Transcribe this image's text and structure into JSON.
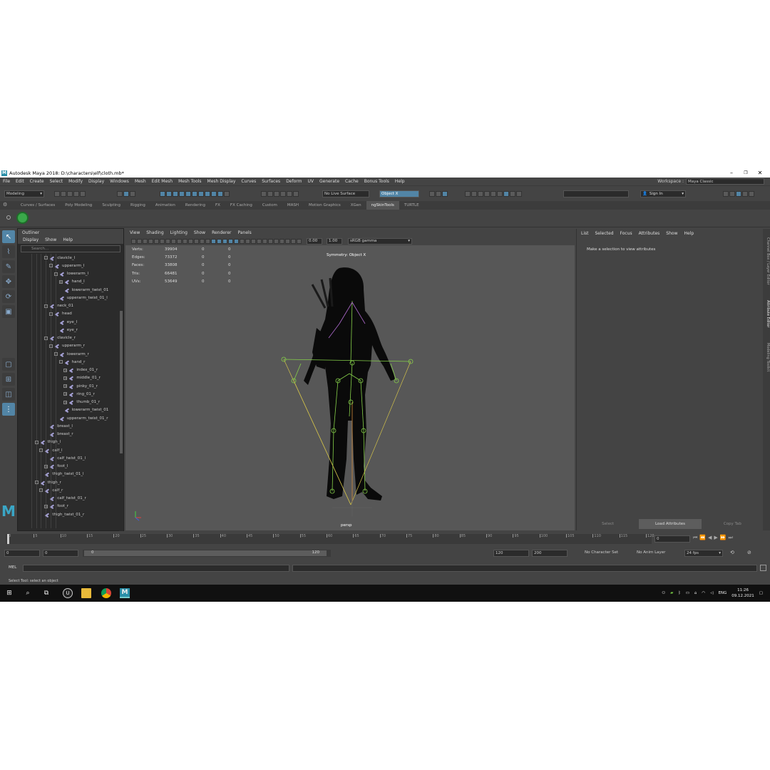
{
  "window": {
    "title": "Autodesk Maya 2018: D:\\characters\\elf\\cloth.mb*",
    "logo": "M"
  },
  "menubar": {
    "items": [
      "File",
      "Edit",
      "Create",
      "Select",
      "Modify",
      "Display",
      "Windows",
      "Mesh",
      "Edit Mesh",
      "Mesh Tools",
      "Mesh Display",
      "Curves",
      "Surfaces",
      "Deform",
      "UV",
      "Generate",
      "Cache",
      "Bonus Tools",
      "Help"
    ],
    "workspace_label": "Workspace :",
    "workspace_value": "Maya Classic"
  },
  "statusline": {
    "mode": "Modeling",
    "live_surface": "No Live Surface",
    "symmetry": "Object X",
    "sign_in": "Sign In"
  },
  "shelf": {
    "tabs": [
      "Curves / Surfaces",
      "Poly Modeling",
      "Sculpting",
      "Rigging",
      "Animation",
      "Rendering",
      "FX",
      "FX Caching",
      "Custom",
      "MASH",
      "Motion Graphics",
      "XGen",
      "ngSkinTools",
      "TURTLE"
    ],
    "active_tab": "ngSkinTools"
  },
  "outliner": {
    "title": "Outliner",
    "menu": [
      "Display",
      "Show",
      "Help"
    ],
    "search_placeholder": "Search...",
    "nodes": [
      {
        "label": "clavicle_l",
        "depth": 4,
        "toggle": "-"
      },
      {
        "label": "upperarm_l",
        "depth": 5,
        "toggle": "-"
      },
      {
        "label": "lowerarm_l",
        "depth": 6,
        "toggle": "-"
      },
      {
        "label": "hand_l",
        "depth": 7,
        "toggle": "+"
      },
      {
        "label": "lowerarm_twist_01",
        "depth": 7,
        "toggle": ""
      },
      {
        "label": "upperarm_twist_01_l",
        "depth": 6,
        "toggle": ""
      },
      {
        "label": "neck_01",
        "depth": 4,
        "toggle": "-"
      },
      {
        "label": "head",
        "depth": 5,
        "toggle": "-"
      },
      {
        "label": "eye_l",
        "depth": 6,
        "toggle": ""
      },
      {
        "label": "eye_r",
        "depth": 6,
        "toggle": ""
      },
      {
        "label": "clavicle_r",
        "depth": 4,
        "toggle": "-"
      },
      {
        "label": "upperarm_r",
        "depth": 5,
        "toggle": "-"
      },
      {
        "label": "lowerarm_r",
        "depth": 6,
        "toggle": "-"
      },
      {
        "label": "hand_r",
        "depth": 7,
        "toggle": "-"
      },
      {
        "label": "index_01_r",
        "depth": 8,
        "toggle": "+"
      },
      {
        "label": "middle_01_r",
        "depth": 8,
        "toggle": "+"
      },
      {
        "label": "pinky_01_r",
        "depth": 8,
        "toggle": "+"
      },
      {
        "label": "ring_01_r",
        "depth": 8,
        "toggle": "+"
      },
      {
        "label": "thumb_01_r",
        "depth": 8,
        "toggle": "+"
      },
      {
        "label": "lowerarm_twist_01",
        "depth": 7,
        "toggle": ""
      },
      {
        "label": "upperarm_twist_01_r",
        "depth": 6,
        "toggle": ""
      },
      {
        "label": "breast_l",
        "depth": 4,
        "toggle": ""
      },
      {
        "label": "breast_r",
        "depth": 4,
        "toggle": ""
      },
      {
        "label": "thigh_l",
        "depth": 2,
        "toggle": "-"
      },
      {
        "label": "calf_l",
        "depth": 3,
        "toggle": "-"
      },
      {
        "label": "calf_twist_01_l",
        "depth": 4,
        "toggle": ""
      },
      {
        "label": "foot_l",
        "depth": 4,
        "toggle": "+"
      },
      {
        "label": "thigh_twist_01_l",
        "depth": 3,
        "toggle": ""
      },
      {
        "label": "thigh_r",
        "depth": 2,
        "toggle": "-"
      },
      {
        "label": "calf_r",
        "depth": 3,
        "toggle": "-"
      },
      {
        "label": "calf_twist_01_r",
        "depth": 4,
        "toggle": ""
      },
      {
        "label": "foot_r",
        "depth": 4,
        "toggle": "+"
      },
      {
        "label": "thigh_twist_01_r",
        "depth": 3,
        "toggle": ""
      }
    ]
  },
  "viewport": {
    "menu": [
      "View",
      "Shading",
      "Lighting",
      "Show",
      "Renderer",
      "Panels"
    ],
    "exposure": "0.00",
    "gamma": "1.00",
    "color_space": "sRGB gamma",
    "hud": [
      {
        "label": "Verts:",
        "v1": "39904",
        "v2": "0",
        "v3": "0"
      },
      {
        "label": "Edges:",
        "v1": "73372",
        "v2": "0",
        "v3": "0"
      },
      {
        "label": "Faces:",
        "v1": "33808",
        "v2": "0",
        "v3": "0"
      },
      {
        "label": "Tris:",
        "v1": "66481",
        "v2": "0",
        "v3": "0"
      },
      {
        "label": "UVs:",
        "v1": "53649",
        "v2": "0",
        "v3": "0"
      }
    ],
    "symmetry_label": "Symmetry: Object X",
    "camera": "persp"
  },
  "attribute_editor": {
    "menu": [
      "List",
      "Selected",
      "Focus",
      "Attributes",
      "Show",
      "Help"
    ],
    "message": "Make a selection to view attributes",
    "buttons": [
      "Select",
      "Load Attributes",
      "Copy Tab"
    ],
    "side_tabs": [
      "Channel Box / Layer Editor",
      "Attribute Editor",
      "Modeling Toolkit"
    ]
  },
  "timeline": {
    "ticks": [
      "0",
      "5",
      "10",
      "15",
      "20",
      "25",
      "30",
      "35",
      "40",
      "45",
      "50",
      "55",
      "60",
      "65",
      "70",
      "75",
      "80",
      "85",
      "90",
      "95",
      "100",
      "105",
      "110",
      "115",
      "120"
    ],
    "current_frame": "0"
  },
  "range": {
    "start": "0",
    "anim_start": "0",
    "slider_start": "0",
    "slider_end": "120",
    "end": "120",
    "anim_end": "200",
    "character_set": "No Character Set",
    "anim_layer": "No Anim Layer",
    "fps": "24 fps"
  },
  "commandline": {
    "label": "MEL"
  },
  "helpline": {
    "text": "Select Tool: select an object"
  },
  "taskbar": {
    "language": "ENG",
    "time": "11:26",
    "date": "09.12.2021"
  },
  "colors": {
    "accent": "#5285a6",
    "joint": "#a7a3d8",
    "bg": "#444444"
  }
}
